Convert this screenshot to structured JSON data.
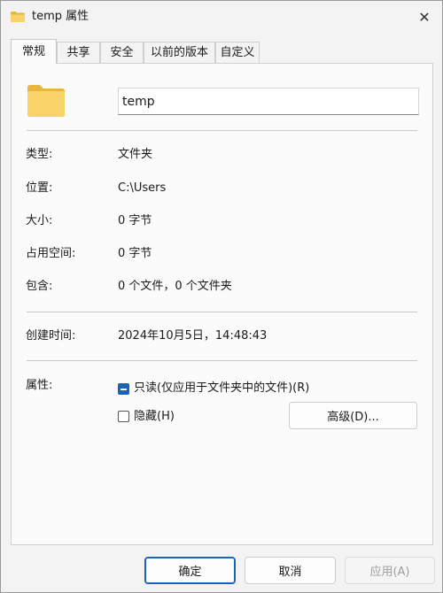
{
  "window": {
    "title": "temp 属性"
  },
  "tabs": [
    {
      "label": "常规",
      "active": true
    },
    {
      "label": "共享",
      "active": false
    },
    {
      "label": "安全",
      "active": false
    },
    {
      "label": "以前的版本",
      "active": false
    },
    {
      "label": "自定义",
      "active": false
    }
  ],
  "general": {
    "name_value": "temp",
    "props": [
      {
        "label": "类型:",
        "value": "文件夹"
      },
      {
        "label": "位置:",
        "value": "C:\\Users"
      },
      {
        "label": "大小:",
        "value": "0 字节"
      },
      {
        "label": "占用空间:",
        "value": "0 字节"
      },
      {
        "label": "包含:",
        "value": "0 个文件，0 个文件夹"
      }
    ],
    "created": {
      "label": "创建时间:",
      "value": "2024年10月5日，14:48:43"
    },
    "attributes": {
      "label": "属性:",
      "readonly_label": "只读(仅应用于文件夹中的文件)(R)",
      "readonly_state": "indeterminate",
      "hidden_label": "隐藏(H)",
      "hidden_state": "unchecked",
      "advanced_label": "高级(D)..."
    }
  },
  "buttons": {
    "ok": "确定",
    "cancel": "取消",
    "apply": "应用(A)"
  },
  "colors": {
    "accent": "#1a62b8",
    "folder": "#f8d36a"
  },
  "icons": {
    "title": "folder-icon",
    "close": "close-icon",
    "main": "folder-icon"
  }
}
